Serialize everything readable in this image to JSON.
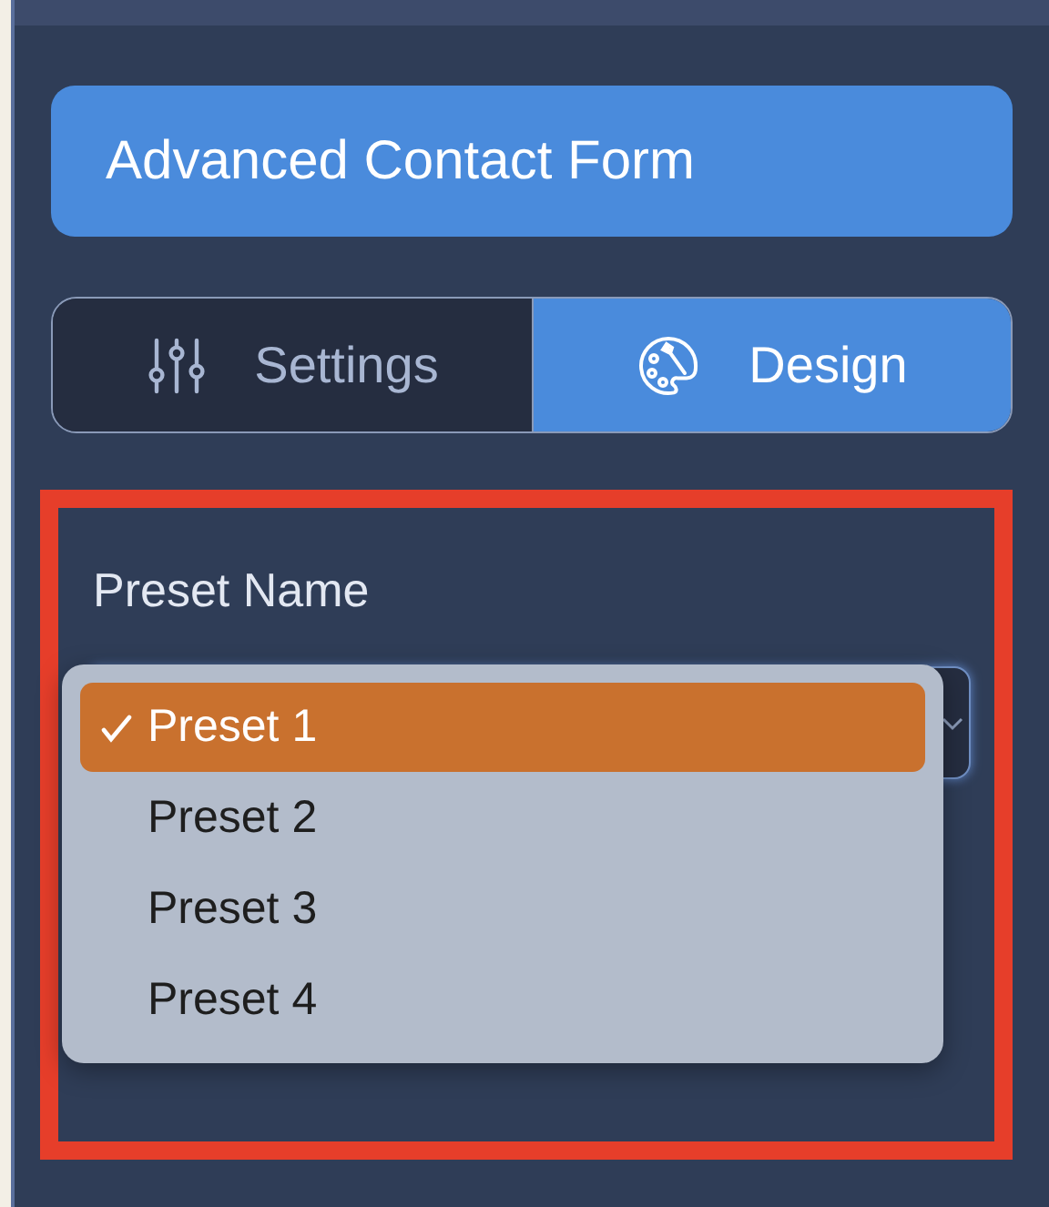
{
  "header": {
    "title": "Advanced Contact Form"
  },
  "tabs": [
    {
      "label": "Settings",
      "selected": false
    },
    {
      "label": "Design",
      "selected": true
    }
  ],
  "preset": {
    "label": "Preset Name",
    "options": [
      {
        "label": "Preset 1",
        "selected": true
      },
      {
        "label": "Preset 2",
        "selected": false
      },
      {
        "label": "Preset 3",
        "selected": false
      },
      {
        "label": "Preset 4",
        "selected": false
      }
    ]
  }
}
